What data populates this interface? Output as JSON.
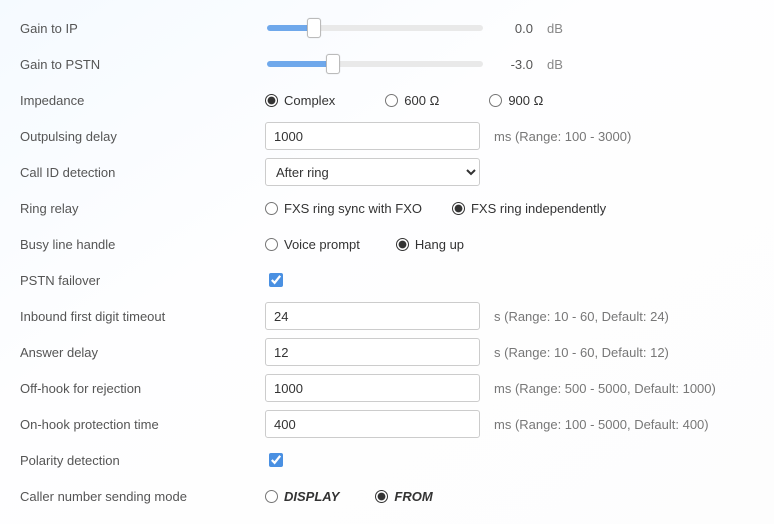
{
  "rows": {
    "gainIp": {
      "label": "Gain to IP",
      "value": "0.0",
      "unit": "dB",
      "pct": 20
    },
    "gainPstn": {
      "label": "Gain to PSTN",
      "value": "-3.0",
      "unit": "dB",
      "pct": 29
    },
    "impedance": {
      "label": "Impedance",
      "options": {
        "complex": "Complex",
        "o600": "600 Ω",
        "o900": "900 Ω"
      },
      "selected": "complex"
    },
    "outpulsing": {
      "label": "Outpulsing delay",
      "value": "1000",
      "hint": "ms (Range: 100 - 3000)"
    },
    "callId": {
      "label": "Call ID detection",
      "value": "After ring"
    },
    "ringRelay": {
      "label": "Ring relay",
      "options": {
        "sync": "FXS ring sync with FXO",
        "indep": "FXS ring independently"
      },
      "selected": "indep"
    },
    "busyLine": {
      "label": "Busy line handle",
      "options": {
        "voice": "Voice prompt",
        "hang": "Hang up"
      },
      "selected": "hang"
    },
    "pstnFail": {
      "label": "PSTN failover",
      "checked": true
    },
    "inFirst": {
      "label": "Inbound first digit timeout",
      "value": "24",
      "hint": "s (Range: 10 - 60, Default: 24)"
    },
    "answerDelay": {
      "label": "Answer delay",
      "value": "12",
      "hint": "s (Range: 10 - 60, Default: 12)"
    },
    "offHook": {
      "label": "Off-hook for rejection",
      "value": "1000",
      "hint": "ms (Range: 500 - 5000, Default: 1000)"
    },
    "onHook": {
      "label": "On-hook protection time",
      "value": "400",
      "hint": "ms (Range: 100 - 5000, Default: 400)"
    },
    "polarity": {
      "label": "Polarity detection",
      "checked": true
    },
    "callerMode": {
      "label": "Caller number sending mode",
      "options": {
        "display": "DISPLAY",
        "from": "FROM"
      },
      "selected": "from"
    }
  }
}
